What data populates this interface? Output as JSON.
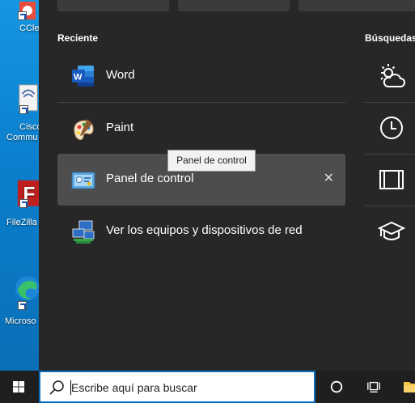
{
  "desktop": {
    "icons": [
      {
        "name": "ccleaner",
        "label": "CCle"
      },
      {
        "name": "cisco",
        "label_line1": "Cisco",
        "label_line2": "Commu"
      },
      {
        "name": "filezilla",
        "label": "FileZilla"
      },
      {
        "name": "edge",
        "label": "Microso"
      }
    ]
  },
  "recent": {
    "title": "Reciente",
    "items": [
      {
        "label": "Word",
        "icon": "word-icon"
      },
      {
        "label": "Paint",
        "icon": "paint-icon"
      },
      {
        "label": "Panel de control",
        "icon": "control-panel-icon",
        "selected": true,
        "remove_glyph": "✕"
      },
      {
        "label": "Ver los equipos y dispositivos de red",
        "icon": "network-devices-icon"
      }
    ]
  },
  "tooltip": "Panel de control",
  "quick_searches": {
    "title": "Búsquedas",
    "items": [
      {
        "icon": "weather-icon"
      },
      {
        "icon": "clock-icon"
      },
      {
        "icon": "film-icon"
      },
      {
        "icon": "graduation-cap-icon"
      }
    ]
  },
  "taskbar": {
    "search_placeholder": "Escribe aquí para buscar",
    "buttons": [
      "start-icon",
      "cortana-icon",
      "task-view-icon",
      "file-explorer-icon"
    ]
  },
  "colors": {
    "panel_bg": "#272727",
    "selected_bg": "#4d4d4d",
    "accent": "#0a6fc2",
    "taskbar_bg": "#1f1f1f"
  }
}
